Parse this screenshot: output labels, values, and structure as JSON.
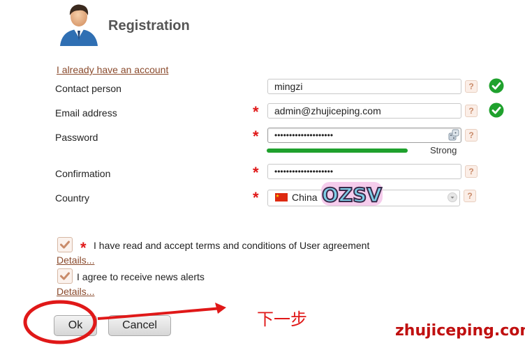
{
  "header": {
    "title": "Registration",
    "avatar_icon": "user-avatar-icon"
  },
  "account_link": "I already have an account",
  "form": {
    "contact_person": {
      "label": "Contact person",
      "value": "mingzi",
      "required": false,
      "valid": true
    },
    "email": {
      "label": "Email address",
      "value": "admin@zhujiceping.com",
      "required": true,
      "valid": true
    },
    "password": {
      "label": "Password",
      "value": "••••••••••••••••••••",
      "required": true,
      "strength_label": "Strong",
      "strength": 1.0
    },
    "confirmation": {
      "label": "Confirmation",
      "value": "••••••••••••••••••••",
      "required": true
    },
    "country": {
      "label": "Country",
      "value": "China",
      "flag_icon": "china-flag-icon"
    },
    "help_symbol": "?",
    "required_symbol": "*"
  },
  "agreements": {
    "terms": {
      "label": "I have read and accept terms and conditions of User agreement",
      "details": "Details...",
      "checked": true,
      "required": true
    },
    "news": {
      "label": "I agree to receive news alerts",
      "details": "Details...",
      "checked": true
    }
  },
  "buttons": {
    "ok": "Ok",
    "cancel": "Cancel"
  },
  "annotation": {
    "text": "下一步"
  },
  "overlay": {
    "logo_text": "OZSV",
    "watermark": "zhujiceping.com"
  },
  "colors": {
    "accent": "#1fa12d",
    "required": "#e01818",
    "link": "#8a4a2c",
    "annotation": "#e01818"
  }
}
